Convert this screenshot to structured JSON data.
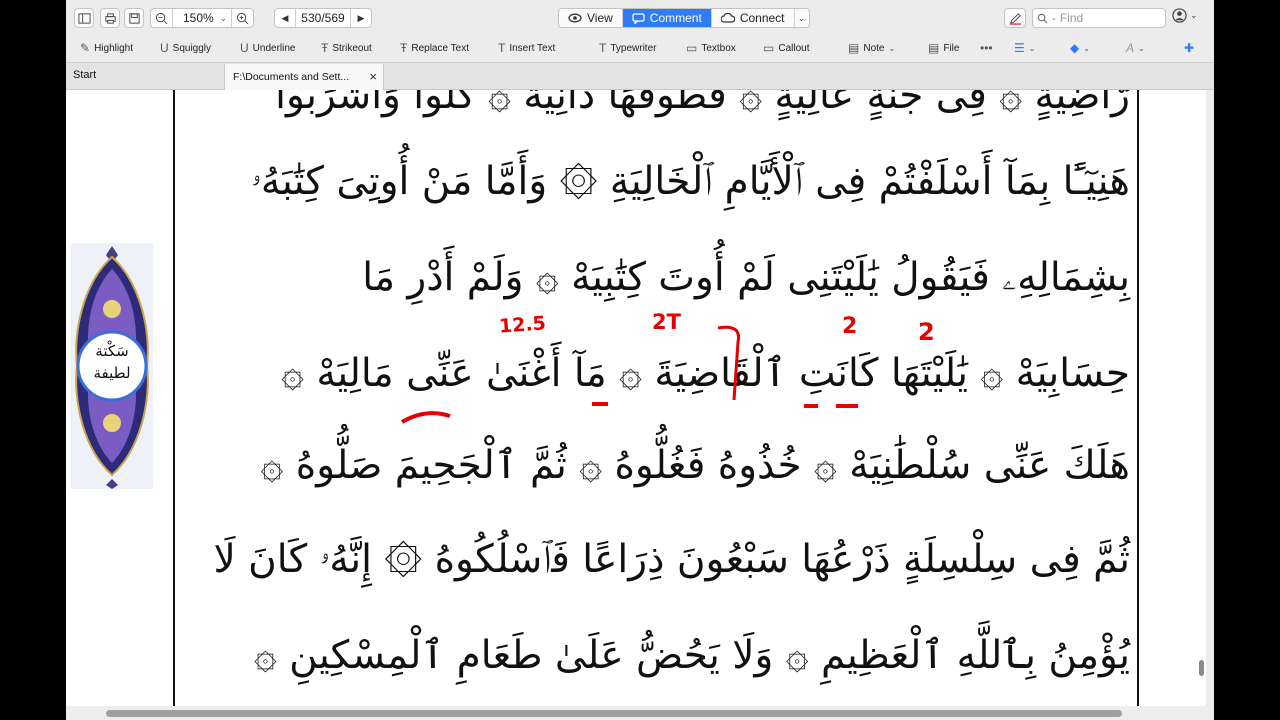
{
  "toolbar": {
    "zoom": "150%",
    "page_indicator": "530/569",
    "modes": [
      {
        "label": "View",
        "active": false
      },
      {
        "label": "Comment",
        "active": true
      },
      {
        "label": "Connect",
        "active": false
      }
    ],
    "find_placeholder": "Find"
  },
  "comment_tools": [
    {
      "label": "Highlight",
      "icon": "highlight-pen-icon"
    },
    {
      "label": "Squiggly",
      "icon": "squiggly-icon"
    },
    {
      "label": "Underline",
      "icon": "underline-icon"
    },
    {
      "label": "Strikeout",
      "icon": "strikeout-icon"
    },
    {
      "label": "Replace Text",
      "icon": "replace-text-icon"
    },
    {
      "label": "Insert Text",
      "icon": "insert-text-icon"
    },
    {
      "label": "Typewriter",
      "icon": "typewriter-icon"
    },
    {
      "label": "Textbox",
      "icon": "textbox-icon"
    },
    {
      "label": "Callout",
      "icon": "callout-icon"
    },
    {
      "label": "Note",
      "icon": "note-icon"
    },
    {
      "label": "File",
      "icon": "file-attach-icon"
    }
  ],
  "tabs": {
    "start": "Start",
    "document": "F:\\Documents and Sett..."
  },
  "ornament_text": [
    "سَكْتة",
    "لطيفة"
  ],
  "quran_lines": [
    "رَّاضِيَةٍ ۞ فِى جَنَّةٍ عَالِيَةٍ ۞ قُطُوفُهَا دَانِيَةٌ ۞ كُلُوا وَاشْرَبُوا",
    "هَنِيٓـًٔا بِمَآ أَسْلَفْتُمْ فِى ٱلْأَيَّامِ ٱلْخَالِيَةِ ۞ وَأَمَّا مَنْ أُوتِىَ كِتَٰبَهُۥ",
    "بِشِمَالِهِۦ فَيَقُولُ يَٰلَيْتَنِى لَمْ أُوتَ كِتَٰبِيَهْ ۞ وَلَمْ أَدْرِ مَا",
    "حِسَابِيَهْ ۞ يَٰلَيْتَهَا كَانَتِ ٱلْقَاضِيَةَ ۞ مَآ أَغْنَىٰ عَنِّى مَالِيَهْ ۞",
    "هَلَكَ عَنِّى سُلْطَٰنِيَهْ ۞ خُذُوهُ فَغُلُّوهُ ۞ ثُمَّ ٱلْجَحِيمَ صَلُّوهُ ۞",
    "ثُمَّ فِى سِلْسِلَةٍ ذَرْعُهَا سَبْعُونَ ذِرَاعًا فَٱسْلُكُوهُ ۞ إِنَّهُۥ كَانَ لَا",
    "يُؤْمِنُ بِٱللَّهِ ٱلْعَظِيمِ ۞ وَلَا يَحُضُّ عَلَىٰ طَعَامِ ٱلْمِسْكِينِ ۞"
  ],
  "annotations": [
    "12.5",
    "2T",
    "2",
    "2"
  ],
  "colors": {
    "accent": "#2f7cf6",
    "annotation": "#e60000"
  }
}
